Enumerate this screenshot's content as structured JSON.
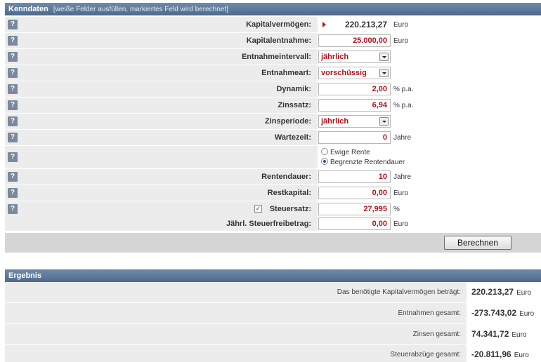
{
  "kenndaten": {
    "title": "Kenndaten",
    "subtitle": "[weiße Felder ausfüllen, markiertes Feld wird berechnet]",
    "help_label": "?",
    "rows": [
      {
        "label": "Kapitalvermögen:",
        "value": "220.213,27",
        "unit": "Euro"
      },
      {
        "label": "Kapitalentnahme:",
        "value": "25.000,00",
        "unit": "Euro"
      },
      {
        "label": "Entnahmeintervall:",
        "value": "jährlich"
      },
      {
        "label": "Entnahmeart:",
        "value": "vorschüssig"
      },
      {
        "label": "Dynamik:",
        "value": "2,00",
        "unit": "% p.a."
      },
      {
        "label": "Zinssatz:",
        "value": "6,94",
        "unit": "% p.a."
      },
      {
        "label": "Zinsperiode:",
        "value": "jährlich"
      },
      {
        "label": "Wartezeit:",
        "value": "0",
        "unit": "Jahre"
      },
      {
        "label": "",
        "options": [
          "Ewige Rente",
          "Begrenzte Rentendauer"
        ],
        "selected": "Begrenzte Rentendauer"
      },
      {
        "label": "Rentendauer:",
        "value": "10",
        "unit": "Jahre"
      },
      {
        "label": "Restkapital:",
        "value": "0,00",
        "unit": "Euro"
      },
      {
        "label": "Steuersatz:",
        "value": "27,995",
        "unit": "%",
        "checked": true
      },
      {
        "label": "Jährl. Steuerfreibetrag:",
        "value": "0,00",
        "unit": "Euro"
      }
    ],
    "calculate_button": "Berechnen"
  },
  "ergebnis": {
    "title": "Ergebnis",
    "rows": [
      {
        "label": "Das benötigte Kapitalvermögen beträgt:",
        "value": "220.213,27",
        "unit": "Euro"
      },
      {
        "label": "Entnahmen gesamt:",
        "value": "-273.743,02",
        "unit": "Euro"
      },
      {
        "label": "Zinsen gesamt:",
        "value": "74.341,72",
        "unit": "Euro"
      },
      {
        "label": "Steuerabzüge gesamt:",
        "value": "-20.811,96",
        "unit": "Euro"
      }
    ]
  },
  "colors": {
    "header": "#5a7698",
    "accent": "#b3121b",
    "row_grey": "#ececec"
  }
}
